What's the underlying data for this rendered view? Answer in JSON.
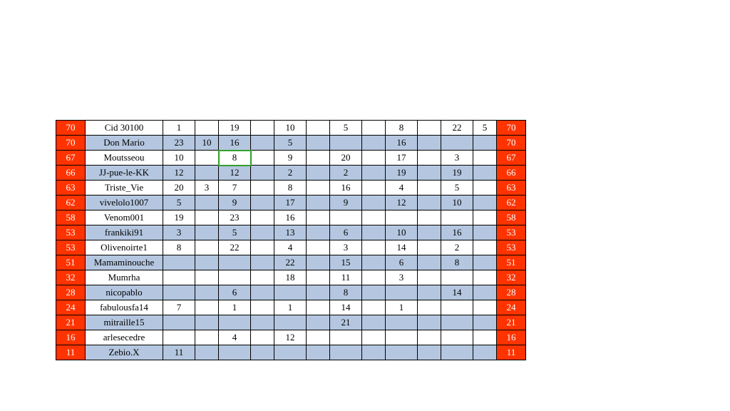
{
  "colors": {
    "rank_bg": "#ff3300",
    "alt_bg": "#b5c7e0",
    "highlight": "#33a02c"
  },
  "highlight_cell": {
    "row": 2,
    "col": 4
  },
  "chart_data": {
    "type": "table",
    "title": "",
    "columns": [
      "rank_left",
      "name",
      "c1",
      "c2",
      "c3",
      "c4",
      "c5",
      "c6",
      "c7",
      "c8",
      "c9",
      "c10",
      "c11",
      "c12",
      "rank_right"
    ],
    "rows": [
      {
        "rank": 70,
        "name": "Cid 30100",
        "cells": [
          "1",
          "",
          "19",
          "",
          "10",
          "",
          "5",
          "",
          "8",
          "",
          "22",
          "5"
        ]
      },
      {
        "rank": 70,
        "name": "Don Mario",
        "cells": [
          "23",
          "10",
          "16",
          "",
          "5",
          "",
          "",
          "",
          "16",
          "",
          "",
          ""
        ]
      },
      {
        "rank": 67,
        "name": "Moutsseou",
        "cells": [
          "10",
          "",
          "8",
          "",
          "9",
          "",
          "20",
          "",
          "17",
          "",
          "3",
          ""
        ]
      },
      {
        "rank": 66,
        "name": "JJ-pue-le-KK",
        "cells": [
          "12",
          "",
          "12",
          "",
          "2",
          "",
          "2",
          "",
          "19",
          "",
          "19",
          ""
        ]
      },
      {
        "rank": 63,
        "name": "Triste_Vie",
        "cells": [
          "20",
          "3",
          "7",
          "",
          "8",
          "",
          "16",
          "",
          "4",
          "",
          "5",
          ""
        ]
      },
      {
        "rank": 62,
        "name": "vivelolo1007",
        "cells": [
          "5",
          "",
          "9",
          "",
          "17",
          "",
          "9",
          "",
          "12",
          "",
          "10",
          ""
        ]
      },
      {
        "rank": 58,
        "name": "Venom001",
        "cells": [
          "19",
          "",
          "23",
          "",
          "16",
          "",
          "",
          "",
          "",
          "",
          "",
          ""
        ]
      },
      {
        "rank": 53,
        "name": "frankiki91",
        "cells": [
          "3",
          "",
          "5",
          "",
          "13",
          "",
          "6",
          "",
          "10",
          "",
          "16",
          ""
        ]
      },
      {
        "rank": 53,
        "name": "Olivenoirte1",
        "cells": [
          "8",
          "",
          "22",
          "",
          "4",
          "",
          "3",
          "",
          "14",
          "",
          "2",
          ""
        ]
      },
      {
        "rank": 51,
        "name": "Mamaminouche",
        "cells": [
          "",
          "",
          "",
          "",
          "22",
          "",
          "15",
          "",
          "6",
          "",
          "8",
          ""
        ]
      },
      {
        "rank": 32,
        "name": "Mumrha",
        "cells": [
          "",
          "",
          "",
          "",
          "18",
          "",
          "11",
          "",
          "3",
          "",
          "",
          ""
        ]
      },
      {
        "rank": 28,
        "name": "nicopablo",
        "cells": [
          "",
          "",
          "6",
          "",
          "",
          "",
          "8",
          "",
          "",
          "",
          "14",
          ""
        ]
      },
      {
        "rank": 24,
        "name": "fabulousfa14",
        "cells": [
          "7",
          "",
          "1",
          "",
          "1",
          "",
          "14",
          "",
          "1",
          "",
          "",
          ""
        ]
      },
      {
        "rank": 21,
        "name": "mitraille15",
        "cells": [
          "",
          "",
          "",
          "",
          "",
          "",
          "21",
          "",
          "",
          "",
          "",
          ""
        ]
      },
      {
        "rank": 16,
        "name": "arlesecedre",
        "cells": [
          "",
          "",
          "4",
          "",
          "12",
          "",
          "",
          "",
          "",
          "",
          "",
          ""
        ]
      },
      {
        "rank": 11,
        "name": "Zebio.X",
        "cells": [
          "11",
          "",
          "",
          "",
          "",
          "",
          "",
          "",
          "",
          "",
          "",
          ""
        ]
      }
    ]
  }
}
